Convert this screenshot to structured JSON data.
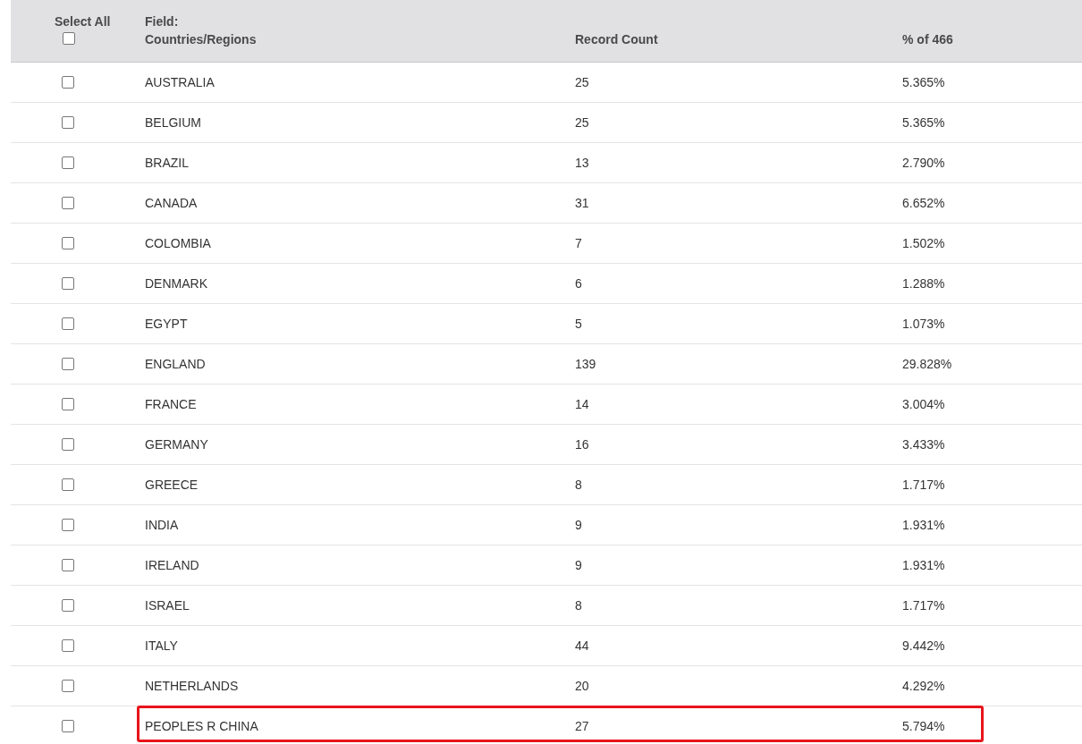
{
  "header": {
    "select_all": {
      "label": "Select All",
      "checked": false
    },
    "field_label": "Field:",
    "field_name": "Countries/Regions",
    "count_label": "Record Count",
    "percent_label": "% of 466"
  },
  "rows": [
    {
      "name": "AUSTRALIA",
      "count": "25",
      "percent": "5.365%",
      "checked": false,
      "highlighted": false
    },
    {
      "name": "BELGIUM",
      "count": "25",
      "percent": "5.365%",
      "checked": false,
      "highlighted": false
    },
    {
      "name": "BRAZIL",
      "count": "13",
      "percent": "2.790%",
      "checked": false,
      "highlighted": false
    },
    {
      "name": "CANADA",
      "count": "31",
      "percent": "6.652%",
      "checked": false,
      "highlighted": false
    },
    {
      "name": "COLOMBIA",
      "count": "7",
      "percent": "1.502%",
      "checked": false,
      "highlighted": false
    },
    {
      "name": "DENMARK",
      "count": "6",
      "percent": "1.288%",
      "checked": false,
      "highlighted": false
    },
    {
      "name": "EGYPT",
      "count": "5",
      "percent": "1.073%",
      "checked": false,
      "highlighted": false
    },
    {
      "name": "ENGLAND",
      "count": "139",
      "percent": "29.828%",
      "checked": false,
      "highlighted": false
    },
    {
      "name": "FRANCE",
      "count": "14",
      "percent": "3.004%",
      "checked": false,
      "highlighted": false
    },
    {
      "name": "GERMANY",
      "count": "16",
      "percent": "3.433%",
      "checked": false,
      "highlighted": false
    },
    {
      "name": "GREECE",
      "count": "8",
      "percent": "1.717%",
      "checked": false,
      "highlighted": false
    },
    {
      "name": "INDIA",
      "count": "9",
      "percent": "1.931%",
      "checked": false,
      "highlighted": false
    },
    {
      "name": "IRELAND",
      "count": "9",
      "percent": "1.931%",
      "checked": false,
      "highlighted": false
    },
    {
      "name": "ISRAEL",
      "count": "8",
      "percent": "1.717%",
      "checked": false,
      "highlighted": false
    },
    {
      "name": "ITALY",
      "count": "44",
      "percent": "9.442%",
      "checked": false,
      "highlighted": false
    },
    {
      "name": "NETHERLANDS",
      "count": "20",
      "percent": "4.292%",
      "checked": false,
      "highlighted": false
    },
    {
      "name": "PEOPLES R CHINA",
      "count": "27",
      "percent": "5.794%",
      "checked": false,
      "highlighted": true
    }
  ]
}
